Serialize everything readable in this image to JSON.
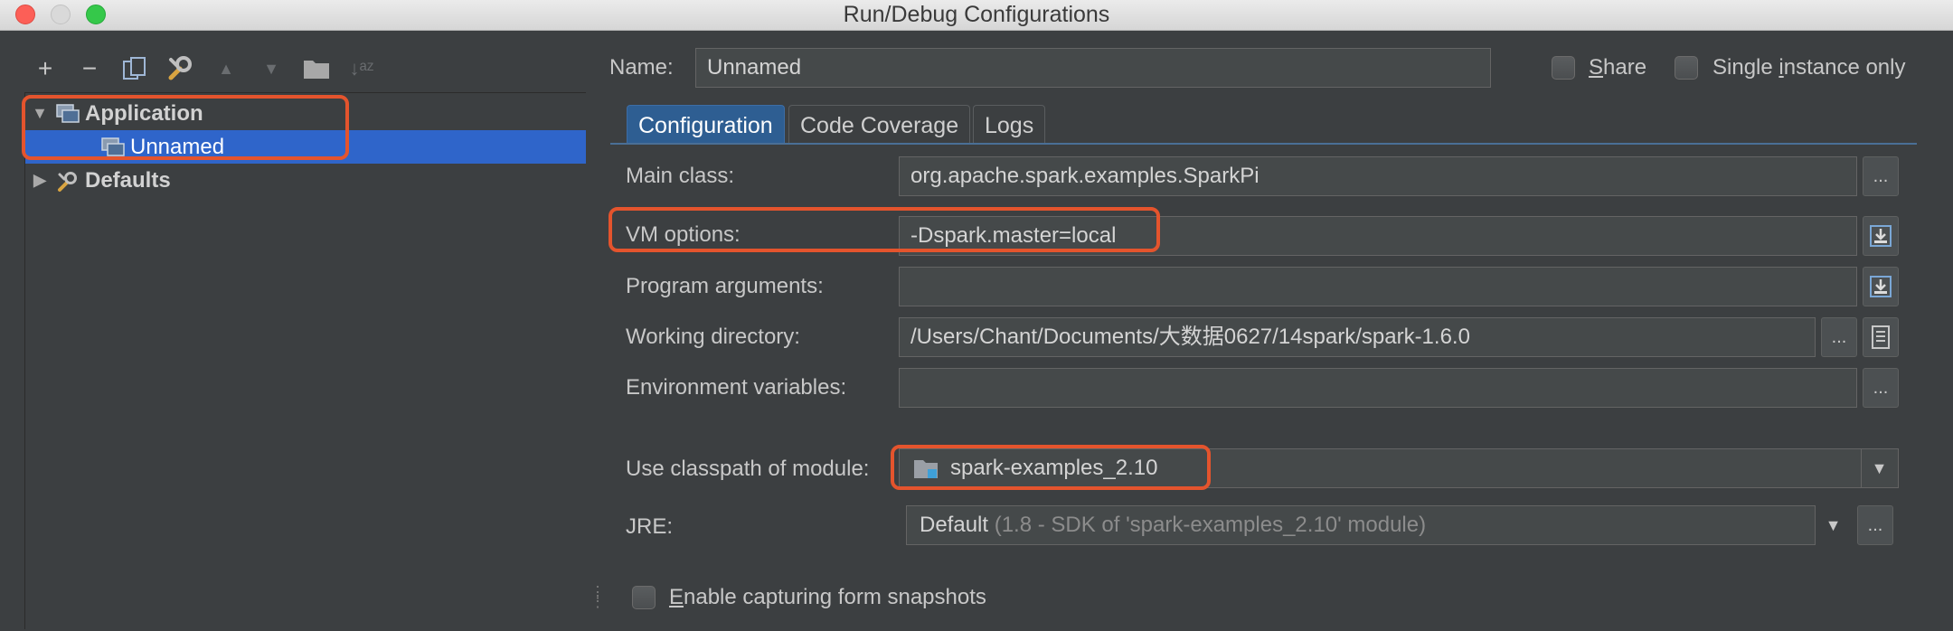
{
  "window": {
    "title": "Run/Debug Configurations"
  },
  "toolbar": {
    "add": "+",
    "remove": "−",
    "copy": "⧉",
    "edit_defaults": "🔧",
    "move_up": "▲",
    "move_down": "▼",
    "folder": "📁",
    "sort": "↓ᵃᶻ"
  },
  "tree": {
    "application_label": "Application",
    "unnamed_label": "Unnamed",
    "defaults_label": "Defaults"
  },
  "form": {
    "name_label": "Name:",
    "name_value": "Unnamed",
    "share_label_pre": "",
    "share_label_u": "S",
    "share_label_post": "hare",
    "single_instance_pre": "Single ",
    "single_instance_u": "i",
    "single_instance_post": "nstance only"
  },
  "tabs": {
    "configuration": "Configuration",
    "code_coverage": "Code Coverage",
    "logs": "Logs"
  },
  "config": {
    "main_class_label": "Main class:",
    "main_class_value": "org.apache.spark.examples.SparkPi",
    "vm_options_label": "VM options:",
    "vm_options_value": "-Dspark.master=local",
    "program_args_label": "Program arguments:",
    "program_args_value": "",
    "working_dir_label": "Working directory:",
    "working_dir_value": "/Users/Chant/Documents/大数据0627/14spark/spark-1.6.0",
    "env_vars_label": "Environment variables:",
    "env_vars_value": "",
    "classpath_label": "Use classpath of module:",
    "classpath_value": "spark-examples_2.10",
    "jre_label": "JRE:",
    "jre_value": "Default",
    "jre_detail": "(1.8 - SDK of 'spark-examples_2.10' module)",
    "snapshots_pre": "",
    "snapshots_u": "E",
    "snapshots_post": "nable capturing form snapshots",
    "ellipsis": "..."
  },
  "colors": {
    "accent_selection": "#2f65ca",
    "callout": "#e4542d",
    "active_tab": "#2e5e92"
  }
}
